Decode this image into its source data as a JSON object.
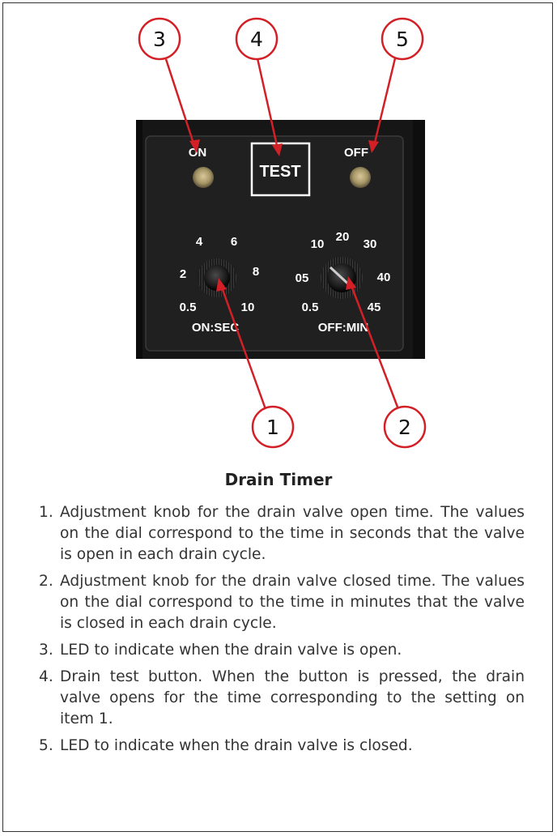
{
  "panel": {
    "led_on_label": "ON",
    "led_off_label": "OFF",
    "test_label": "TEST",
    "on_dial": {
      "caption": "ON:SEC",
      "ticks": [
        "0.5",
        "2",
        "4",
        "6",
        "8",
        "10"
      ]
    },
    "off_dial": {
      "caption": "OFF:MIN",
      "ticks": [
        "0.5",
        "05",
        "10",
        "20",
        "30",
        "40",
        "45"
      ]
    }
  },
  "callouts": [
    "1",
    "2",
    "3",
    "4",
    "5"
  ],
  "caption": "Drain Timer",
  "legend": [
    {
      "num": "1.",
      "text": "Adjustment knob for the drain valve open time. The values on the dial correspond to the time in seconds that the valve is open in each drain cycle."
    },
    {
      "num": "2.",
      "text": "Adjustment knob for the drain valve closed time. The values on the dial correspond to the time in minutes that the valve is closed in each drain cycle."
    },
    {
      "num": "3.",
      "text": "LED to indicate when the drain valve is open."
    },
    {
      "num": "4.",
      "text": "Drain test button. When the button is pressed, the drain valve opens for the time corresponding to the setting on item 1."
    },
    {
      "num": "5.",
      "text": "LED to indicate when the drain valve is closed."
    }
  ],
  "colors": {
    "callout_stroke": "#d32027",
    "panel": "#1b1b1b",
    "led": "#b8a878"
  }
}
